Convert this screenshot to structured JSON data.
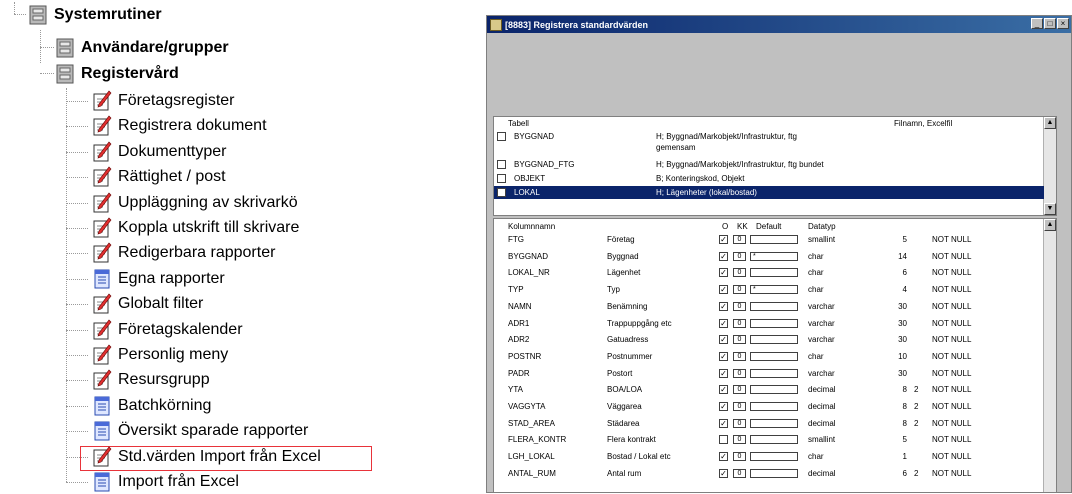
{
  "tree": {
    "root": "Systemrutiner",
    "groups": [
      "Användare/grupper",
      "Registervård"
    ],
    "items": [
      {
        "label": "Företagsregister",
        "icon": "pencil-document-icon"
      },
      {
        "label": "Registrera dokument",
        "icon": "pencil-document-icon"
      },
      {
        "label": "Dokumenttyper",
        "icon": "pencil-document-icon"
      },
      {
        "label": "Rättighet / post",
        "icon": "pencil-document-icon"
      },
      {
        "label": "Uppläggning av skrivarkö",
        "icon": "pencil-document-icon"
      },
      {
        "label": "Koppla utskrift till skrivare",
        "icon": "pencil-document-icon"
      },
      {
        "label": "Redigerbara rapporter",
        "icon": "pencil-document-icon"
      },
      {
        "label": "Egna rapporter",
        "icon": "report-document-icon"
      },
      {
        "label": "Globalt filter",
        "icon": "pencil-document-icon"
      },
      {
        "label": "Företagskalender",
        "icon": "pencil-document-icon"
      },
      {
        "label": "Personlig meny",
        "icon": "pencil-document-icon"
      },
      {
        "label": "Resursgrupp",
        "icon": "pencil-document-icon"
      },
      {
        "label": "Batchkörning",
        "icon": "report-document-icon"
      },
      {
        "label": "Översikt sparade rapporter",
        "icon": "report-document-icon"
      },
      {
        "label": "Std.värden Import från Excel",
        "icon": "pencil-document-icon"
      },
      {
        "label": "Import från Excel",
        "icon": "report-document-icon"
      }
    ],
    "highlight_color": "#e8333a"
  },
  "window": {
    "title": "[8883] Registrera standardvärden",
    "buttons": [
      "_",
      "□",
      "×"
    ],
    "table_list": {
      "header_left": "Tabell",
      "header_right": "Filnamn, Excelfil",
      "rows": [
        {
          "name": "BYGGNAD",
          "desc": "H; Byggnad/Markobjekt/Infrastruktur, ftg",
          "desc2": "gemensam",
          "checked": false
        },
        {
          "name": "BYGGNAD_FTG",
          "desc": "H; Byggnad/Markobjekt/Infrastruktur, ftg bundet",
          "checked": false
        },
        {
          "name": "OBJEKT",
          "desc": "B; Konteringskod, Objekt",
          "checked": false
        },
        {
          "name": "LOKAL",
          "desc": "H; Lägenheter (lokal/bostad)",
          "checked": false,
          "selected": true
        }
      ]
    },
    "columns": {
      "headers": {
        "name": "Kolumnnamn",
        "o": "O",
        "kk": "KK",
        "default": "Default",
        "datatype": "Datatyp"
      },
      "rows": [
        {
          "name": "FTG",
          "desc": "Företag",
          "o": true,
          "kk": "0",
          "def": "",
          "type": "smallint",
          "len": "5",
          "dec": "",
          "null": "NOT NULL"
        },
        {
          "name": "BYGGNAD",
          "desc": "Byggnad",
          "o": true,
          "kk": "0",
          "def": "*",
          "type": "char",
          "len": "14",
          "dec": "",
          "null": "NOT NULL"
        },
        {
          "name": "LOKAL_NR",
          "desc": "Lägenhet",
          "o": true,
          "kk": "0",
          "def": "",
          "type": "char",
          "len": "6",
          "dec": "",
          "null": "NOT NULL"
        },
        {
          "name": "TYP",
          "desc": "Typ",
          "o": true,
          "kk": "0",
          "def": "*",
          "type": "char",
          "len": "4",
          "dec": "",
          "null": "NOT NULL"
        },
        {
          "name": "NAMN",
          "desc": "Benämning",
          "o": true,
          "kk": "0",
          "def": "",
          "type": "varchar",
          "len": "30",
          "dec": "",
          "null": "NOT NULL"
        },
        {
          "name": "ADR1",
          "desc": "Trappuppgång etc",
          "o": true,
          "kk": "0",
          "def": "",
          "type": "varchar",
          "len": "30",
          "dec": "",
          "null": "NOT NULL"
        },
        {
          "name": "ADR2",
          "desc": "Gatuadress",
          "o": true,
          "kk": "0",
          "def": "",
          "type": "varchar",
          "len": "30",
          "dec": "",
          "null": "NOT NULL"
        },
        {
          "name": "POSTNR",
          "desc": "Postnummer",
          "o": true,
          "kk": "0",
          "def": "",
          "type": "char",
          "len": "10",
          "dec": "",
          "null": "NOT NULL"
        },
        {
          "name": "PADR",
          "desc": "Postort",
          "o": true,
          "kk": "0",
          "def": "",
          "type": "varchar",
          "len": "30",
          "dec": "",
          "null": "NOT NULL"
        },
        {
          "name": "YTA",
          "desc": "BOA/LOA",
          "o": true,
          "kk": "0",
          "def": "",
          "type": "decimal",
          "len": "8",
          "dec": "2",
          "null": "NOT NULL"
        },
        {
          "name": "VAGGYTA",
          "desc": "Väggarea",
          "o": true,
          "kk": "0",
          "def": "",
          "type": "decimal",
          "len": "8",
          "dec": "2",
          "null": "NOT NULL"
        },
        {
          "name": "STAD_AREA",
          "desc": "Städarea",
          "o": true,
          "kk": "0",
          "def": "",
          "type": "decimal",
          "len": "8",
          "dec": "2",
          "null": "NOT NULL"
        },
        {
          "name": "FLERA_KONTR",
          "desc": "Flera kontrakt",
          "o": false,
          "kk": "0",
          "def": "",
          "type": "smallint",
          "len": "5",
          "dec": "",
          "null": "NOT NULL"
        },
        {
          "name": "LGH_LOKAL",
          "desc": "Bostad / Lokal etc",
          "o": true,
          "kk": "0",
          "def": "",
          "type": "char",
          "len": "1",
          "dec": "",
          "null": "NOT NULL"
        },
        {
          "name": "ANTAL_RUM",
          "desc": "Antal rum",
          "o": true,
          "kk": "0",
          "def": "",
          "type": "decimal",
          "len": "6",
          "dec": "2",
          "null": "NOT NULL"
        }
      ]
    }
  }
}
